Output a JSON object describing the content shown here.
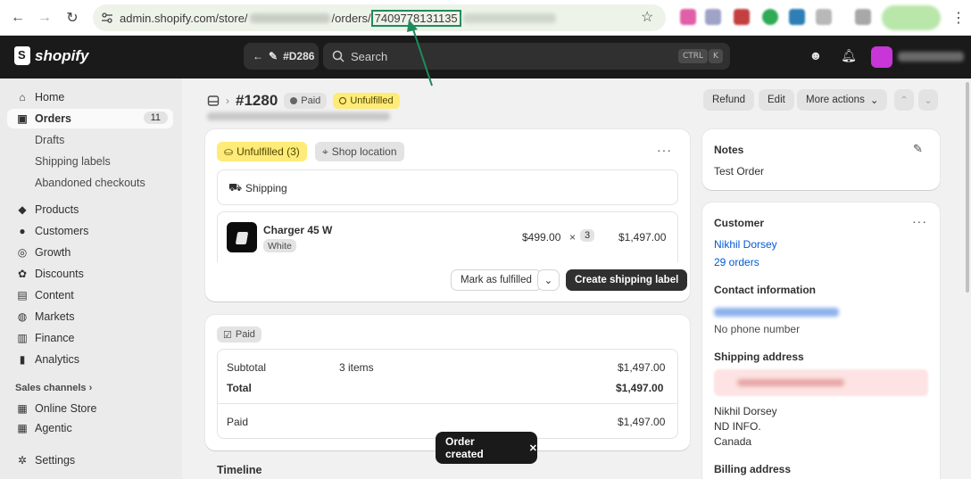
{
  "browser": {
    "url_prefix": "admin.shopify.com/store/",
    "url_mid": "/orders/",
    "order_id": "7409778131135",
    "nav_back": "←",
    "nav_forward": "→",
    "nav_reload": "↻",
    "star": "☆",
    "menu": "⋮"
  },
  "topbar": {
    "logo": "shopify",
    "back_label": "#D286",
    "search_placeholder": "Search",
    "kbd_ctrl": "CTRL",
    "kbd_k": "K"
  },
  "sidebar": {
    "items": [
      {
        "label": "Home",
        "icon": "⌂"
      },
      {
        "label": "Orders",
        "icon": "▣",
        "count": "11"
      },
      {
        "label": "Drafts"
      },
      {
        "label": "Shipping labels"
      },
      {
        "label": "Abandoned checkouts"
      },
      {
        "label": "Products",
        "icon": "◆"
      },
      {
        "label": "Customers",
        "icon": "●"
      },
      {
        "label": "Growth",
        "icon": "◎"
      },
      {
        "label": "Discounts",
        "icon": "✿"
      },
      {
        "label": "Content",
        "icon": "▤"
      },
      {
        "label": "Markets",
        "icon": "◍"
      },
      {
        "label": "Finance",
        "icon": "▥"
      },
      {
        "label": "Analytics",
        "icon": "▮"
      }
    ],
    "sales_channels_label": "Sales channels",
    "channels": [
      {
        "label": "Online Store",
        "icon": "▦"
      },
      {
        "label": "Agentic",
        "icon": "▦"
      }
    ],
    "settings_label": "Settings",
    "settings_icon": "✲"
  },
  "order": {
    "number": "#1280",
    "payment_badge": "Paid",
    "fulfillment_badge": "Unfulfilled",
    "actions": {
      "refund": "Refund",
      "edit": "Edit",
      "more": "More actions"
    }
  },
  "fulfillment_card": {
    "status": "Unfulfilled (3)",
    "location": "Shop location",
    "shipping_label": "Shipping",
    "product_name": "Charger 45 W",
    "variant": "White",
    "unit_price": "$499.00",
    "times": "×",
    "quantity": "3",
    "line_total": "$1,497.00",
    "mark_fulfilled": "Mark as fulfilled",
    "create_label": "Create shipping label"
  },
  "payment_card": {
    "badge": "Paid",
    "subtotal_label": "Subtotal",
    "subtotal_items": "3 items",
    "subtotal_value": "$1,497.00",
    "total_label": "Total",
    "total_value": "$1,497.00",
    "paid_label": "Paid",
    "paid_value": "$1,497.00"
  },
  "timeline_label": "Timeline",
  "notes": {
    "title": "Notes",
    "text": "Test Order"
  },
  "customer": {
    "title": "Customer",
    "name": "Nikhil Dorsey",
    "orders": "29 orders",
    "contact_title": "Contact information",
    "phone": "No phone number",
    "shipping_title": "Shipping address",
    "address_lines": [
      "Nikhil Dorsey",
      "ND INFO.",
      "Canada"
    ],
    "billing_title": "Billing address"
  },
  "toast": {
    "text": "Order created",
    "close": "✕"
  },
  "colors": {
    "annotation": "#1f8a5b",
    "unfulfilled_bg": "#ffeb78",
    "primary_dark": "#303030",
    "link": "#005bd3"
  }
}
